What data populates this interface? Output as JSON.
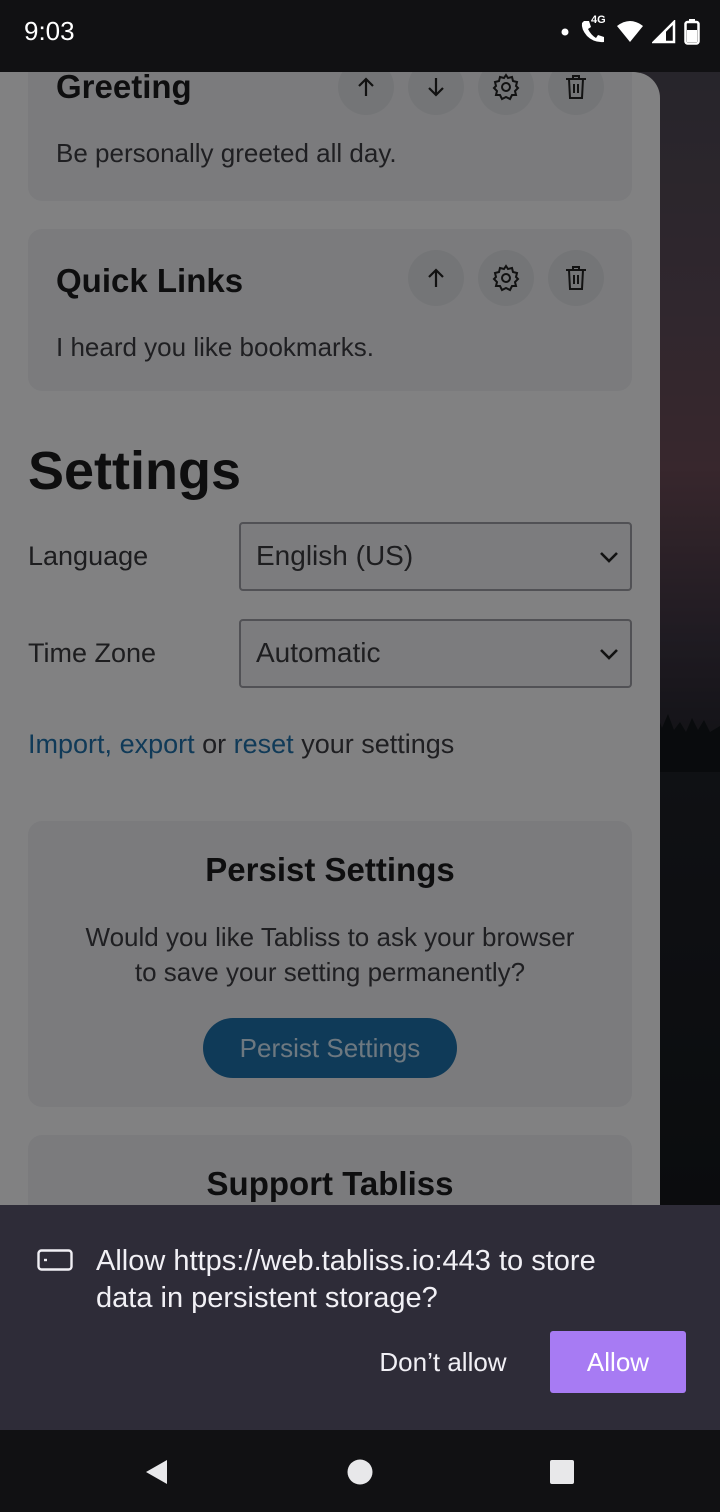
{
  "status_bar": {
    "time": "9:03",
    "network_label": "4G",
    "icons": [
      "notification-dot-icon",
      "wifi-call-icon",
      "wifi-icon",
      "cellular-signal-icon",
      "battery-icon"
    ]
  },
  "widgets": [
    {
      "title": "Greeting",
      "description": "Be personally greeted all day.",
      "actions": [
        "arrow-up-icon",
        "arrow-down-icon",
        "gear-icon",
        "trash-icon"
      ]
    },
    {
      "title": "Quick Links",
      "description": "I heard you like bookmarks.",
      "actions": [
        "arrow-up-icon",
        "gear-icon",
        "trash-icon"
      ]
    }
  ],
  "settings": {
    "heading": "Settings",
    "language": {
      "label": "Language",
      "value": "English (US)"
    },
    "time_zone": {
      "label": "Time Zone",
      "value": "Automatic"
    },
    "links": {
      "import": "Import",
      "comma": ",",
      "export": "export",
      "or": "or",
      "reset": "reset",
      "suffix": "your settings"
    }
  },
  "persist_card": {
    "title": "Persist Settings",
    "description_line1": "Would you like Tabliss to ask your browser",
    "description_line2": "to save your setting permanently?",
    "button": "Persist Settings"
  },
  "support_card": {
    "title": "Support Tabliss"
  },
  "permission_prompt": {
    "icon": "storage-icon",
    "line1": "Allow https://web.tabliss.io:443 to store",
    "line2": "data in persistent storage?",
    "deny_label": "Don’t allow",
    "allow_label": "Allow",
    "accent_color": "#a77bf3"
  },
  "colors": {
    "link": "#1f6fa6",
    "primary_button": "#1d6ea6",
    "prompt_background": "#2e2c38"
  }
}
